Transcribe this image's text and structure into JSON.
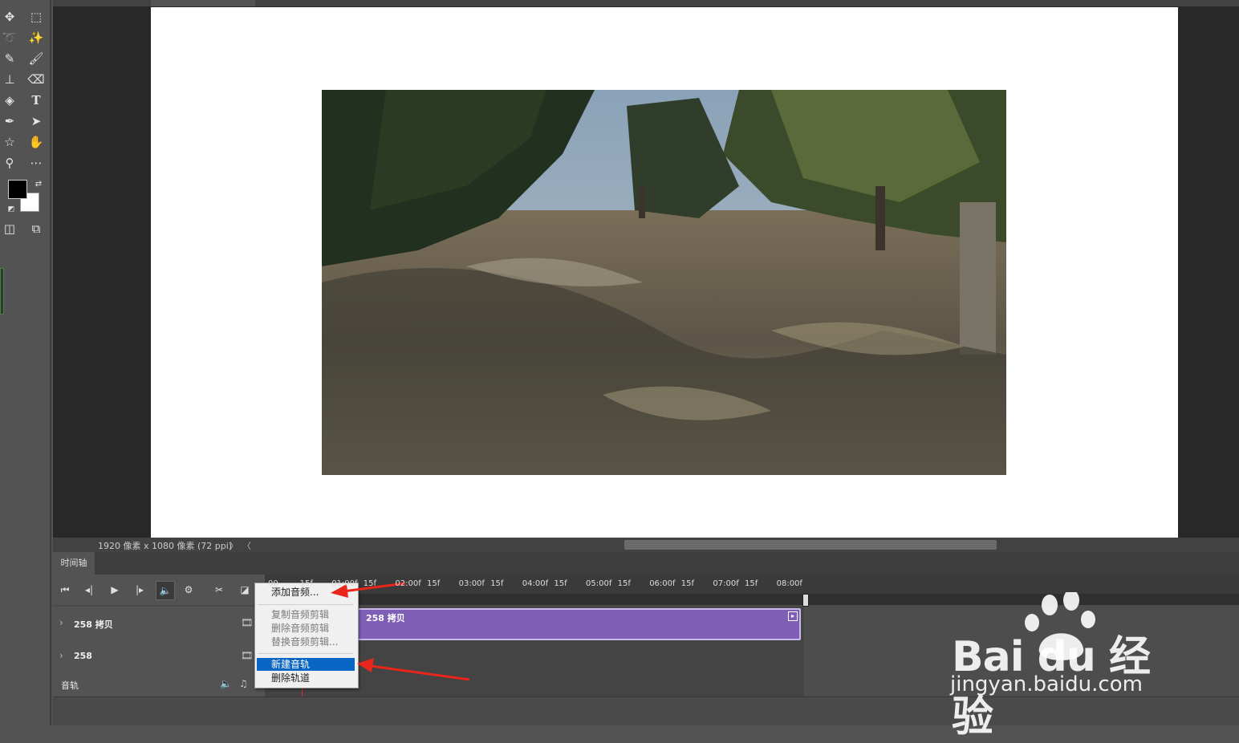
{
  "status_bar": {
    "document_size": "1920 像素 x 1080 像素 (72 ppi)",
    "next_arrow": "〉",
    "prev_arrow": "〈"
  },
  "timeline": {
    "tab_label": "时间轴",
    "ruler_ticks": [
      "00",
      "15f",
      "01:00f",
      "15f",
      "02:00f",
      "15f",
      "03:00f",
      "15f",
      "04:00f",
      "15f",
      "05:00f",
      "15f",
      "06:00f",
      "15f",
      "07:00f",
      "15f",
      "08:00f"
    ],
    "tracks": [
      {
        "name": "258 拷贝",
        "clip_label": "258 拷贝"
      },
      {
        "name": "258"
      }
    ],
    "audio_track": {
      "name": "音轨"
    }
  },
  "context_menu": {
    "items": [
      {
        "label": "添加音频...",
        "state": "normal"
      },
      {
        "label": "复制音频剪辑",
        "state": "disabled"
      },
      {
        "label": "删除音频剪辑",
        "state": "disabled"
      },
      {
        "label": "替换音频剪辑...",
        "state": "disabled"
      },
      {
        "label": "新建音轨",
        "state": "selected"
      },
      {
        "label": "删除轨道",
        "state": "normal"
      }
    ]
  },
  "watermark": {
    "brand": "Bai du 经验",
    "url": "jingyan.baidu.com"
  },
  "colors": {
    "clip_purple": "#7e5fb5",
    "menu_highlight": "#0a66c4",
    "annotation_arrow": "#e8261c",
    "playhead": "#e22233"
  },
  "icons": [
    "move-icon",
    "marquee-icon",
    "lasso-icon",
    "magic-wand-icon",
    "eyedropper-icon",
    "brush-icon",
    "stamp-icon",
    "eraser-icon",
    "paint-bucket-icon",
    "type-icon",
    "pen-icon",
    "path-select-icon",
    "shape-icon",
    "hand-icon",
    "zoom-icon",
    "more-icon"
  ]
}
